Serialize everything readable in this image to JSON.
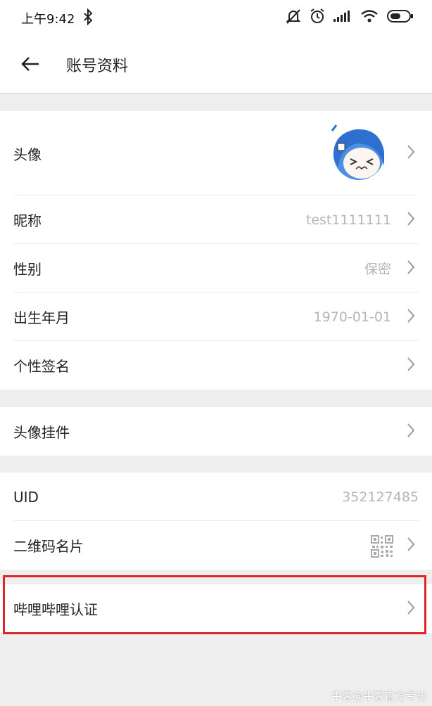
{
  "status_bar": {
    "time": "上午9:42",
    "icons": [
      "bluetooth-icon",
      "mute-icon",
      "alarm-icon",
      "signal-icon",
      "wifi-icon",
      "battery-icon"
    ]
  },
  "header": {
    "title": "账号资料",
    "back_icon": "arrow-left-icon"
  },
  "profile_group": {
    "avatar_label": "头像",
    "nickname_label": "昵称",
    "nickname_value": "test1111111",
    "gender_label": "性别",
    "gender_value": "保密",
    "birthday_label": "出生年月",
    "birthday_value": "1970-01-01",
    "signature_label": "个性签名"
  },
  "pendant_group": {
    "pendant_label": "头像挂件"
  },
  "id_group": {
    "uid_label": "UID",
    "uid_value": "352127485",
    "qrcode_label": "二维码名片"
  },
  "verify_group": {
    "verify_label": "哔哩哔哩认证"
  },
  "watermark": "牛客@牛客官方专刊",
  "colors": {
    "background": "#eeeeee",
    "highlight_border": "#e3232a",
    "secondary_text": "#b6b6b6"
  }
}
